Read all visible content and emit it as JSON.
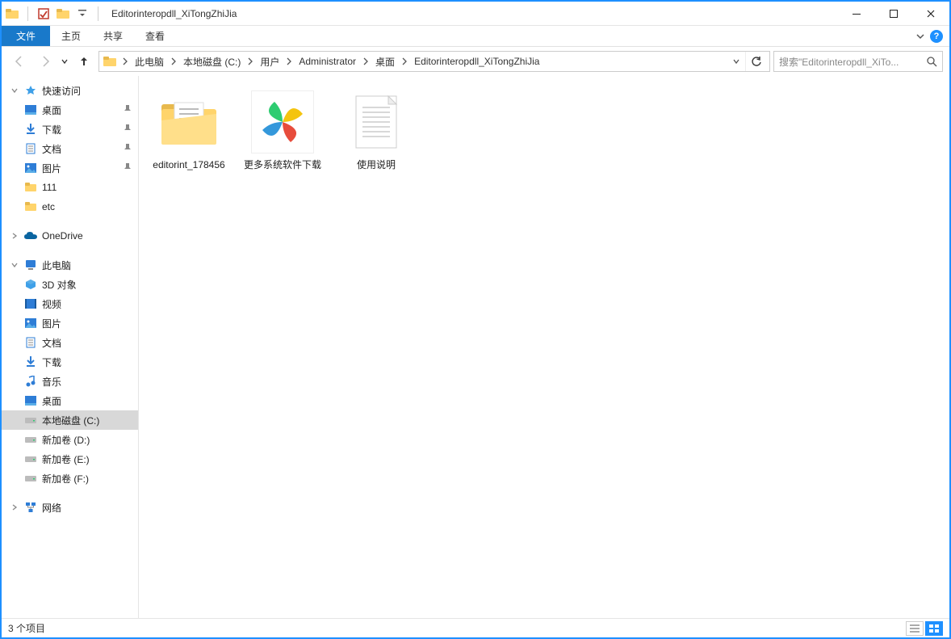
{
  "titlebar": {
    "title": "Editorinteropdll_XiTongZhiJia"
  },
  "ribbon": {
    "file": "文件",
    "home": "主页",
    "share": "共享",
    "view": "查看"
  },
  "breadcrumb": {
    "root": "此电脑",
    "drive": "本地磁盘 (C:)",
    "users": "用户",
    "admin": "Administrator",
    "desktop": "桌面",
    "folder": "Editorinteropdll_XiTongZhiJia"
  },
  "search": {
    "placeholder": "搜索\"Editorinteropdll_XiTo..."
  },
  "nav": {
    "quick_access": "快速访问",
    "qa_desktop": "桌面",
    "qa_downloads": "下载",
    "qa_documents": "文档",
    "qa_pictures": "图片",
    "qa_111": "111",
    "qa_etc": "etc",
    "onedrive": "OneDrive",
    "this_pc": "此电脑",
    "pc_3d": "3D 对象",
    "pc_videos": "视频",
    "pc_pictures": "图片",
    "pc_documents": "文档",
    "pc_downloads": "下载",
    "pc_music": "音乐",
    "pc_desktop": "桌面",
    "pc_drive_c": "本地磁盘 (C:)",
    "pc_drive_d": "新加卷 (D:)",
    "pc_drive_e": "新加卷 (E:)",
    "pc_drive_f": "新加卷 (F:)",
    "network": "网络"
  },
  "files": {
    "item1": "editorint_178456",
    "item2": "更多系统软件下载",
    "item3": "使用说明"
  },
  "status": {
    "count": "3 个项目"
  },
  "colors": {
    "accent": "#1e90ff",
    "ribbon_file": "#1979ca"
  }
}
